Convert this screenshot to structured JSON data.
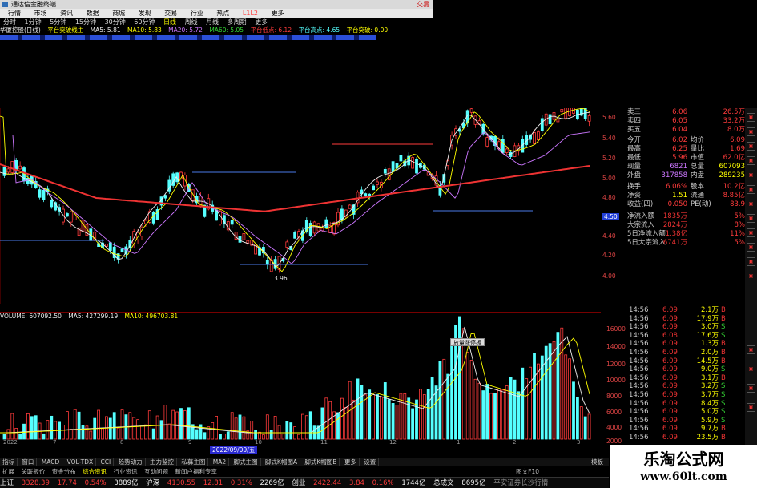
{
  "titlebar": {
    "title": "通达信金融终端",
    "right_label": "交易"
  },
  "menubar": {
    "items": [
      "行情",
      "市场",
      "资讯",
      "数据",
      "商城",
      "发现",
      "交易",
      "行业",
      "热点",
      "L1L2",
      "更多"
    ]
  },
  "periodbar": {
    "items": [
      "分时",
      "1分钟",
      "5分钟",
      "15分钟",
      "30分钟",
      "60分钟",
      "日线",
      "周线",
      "月线",
      "多周期",
      "更多"
    ],
    "active": "日线"
  },
  "maline": {
    "stock": "华厦控股(日线)",
    "indicator": "平台突破线主",
    "ma5": "MA5: 5.81",
    "ma10": "MA10: 5.83",
    "ma20": "MA20: 5.72",
    "ma60": "MA60: 5.05",
    "pt_low": "平台低点: 6.12",
    "pt_high": "平台高点: 4.65",
    "pt_break": "平台突破: 0.00"
  },
  "chart_axis": {
    "price_ticks": [
      "5.60",
      "5.40",
      "5.20",
      "5.00",
      "4.80",
      "4.60",
      "4.40",
      "4.20",
      "4.00"
    ],
    "price_marker": "4.50",
    "low_label": "3.96",
    "volume_ticks": [
      "16000",
      "14000",
      "12000",
      "10000",
      "8000",
      "6000",
      "4000",
      "2000"
    ],
    "x_labels": [
      "2022",
      "7",
      "8",
      "9",
      "10",
      "11",
      "12",
      "1",
      "2",
      "3"
    ],
    "date_tag": "2022/09/09/五"
  },
  "volbar": {
    "label": "VOLUME: 607092.50",
    "ma5": "MA5: 427299.19",
    "ma10": "MA10: 496703.81"
  },
  "tooltip": "放量涨停板",
  "quote": {
    "rows": [
      {
        "a": "卖三",
        "b": "6.06",
        "d": "26.5万"
      },
      {
        "a": "卖四",
        "b": "6.05",
        "d": "33.2万"
      },
      {
        "a": "买五",
        "b": "6.04",
        "d": "8.0万"
      },
      {
        "a": "今开",
        "b": "6.02",
        "c": "均价",
        "d": "6.09"
      },
      {
        "a": "最高",
        "b": "6.25",
        "c": "量比",
        "d": "1.69"
      },
      {
        "a": "最低",
        "b": "5.96",
        "c": "市值",
        "d": "62.0亿"
      },
      {
        "a": "现量",
        "b": "6821",
        "c": "总量",
        "d": "607093"
      },
      {
        "a": "外盘",
        "b": "317858",
        "c": "内盘",
        "d": "289235"
      },
      {
        "a": "换手",
        "b": "6.06%",
        "c": "股本",
        "d": "10.2亿"
      },
      {
        "a": "净资",
        "b": "1.51",
        "c": "流通",
        "d": "8.85亿"
      },
      {
        "a": "收益(四)",
        "b": "0.050",
        "c": "PE(动)",
        "d": "83.9"
      },
      {
        "a": "净流入额",
        "b": "1835万",
        "d": "5%"
      },
      {
        "a": "大宗流入",
        "b": "2824万",
        "d": "8%"
      },
      {
        "a": "5日净流入额",
        "b": "1.38亿",
        "d": "11%"
      },
      {
        "a": "5日大宗流入",
        "b": "6741万",
        "d": "5%"
      }
    ]
  },
  "ticks": {
    "rows": [
      {
        "t": "14:56",
        "p": "6.09",
        "v": "2.1万",
        "s": "B"
      },
      {
        "t": "14:56",
        "p": "6.09",
        "v": "17.9万",
        "s": "B"
      },
      {
        "t": "14:56",
        "p": "6.09",
        "v": "3.0万",
        "s": "S"
      },
      {
        "t": "14:56",
        "p": "6.08",
        "v": "17.6万",
        "s": "S"
      },
      {
        "t": "14:56",
        "p": "6.09",
        "v": "1.3万",
        "s": "B"
      },
      {
        "t": "14:56",
        "p": "6.09",
        "v": "2.0万",
        "s": "B"
      },
      {
        "t": "14:56",
        "p": "6.09",
        "v": "14.5万",
        "s": "B"
      },
      {
        "t": "14:56",
        "p": "6.09",
        "v": "9.0万",
        "s": "S"
      },
      {
        "t": "14:56",
        "p": "6.09",
        "v": "3.1万",
        "s": "B"
      },
      {
        "t": "14:56",
        "p": "6.09",
        "v": "3.2万",
        "s": "S"
      },
      {
        "t": "14:56",
        "p": "6.09",
        "v": "3.7万",
        "s": "S"
      },
      {
        "t": "14:56",
        "p": "6.09",
        "v": "8.4万",
        "s": "S"
      },
      {
        "t": "14:56",
        "p": "6.09",
        "v": "5.0万",
        "s": "S"
      },
      {
        "t": "14:56",
        "p": "6.09",
        "v": "5.9万",
        "s": "S"
      },
      {
        "t": "14:56",
        "p": "6.09",
        "v": "9.7万",
        "s": "B"
      },
      {
        "t": "14:56",
        "p": "6.09",
        "v": "23.5万",
        "s": "B"
      }
    ]
  },
  "tabbar": {
    "items": [
      "指标",
      "窗口",
      "MACD",
      "VOL-TDX",
      "CCI",
      "趋势动力",
      "主力监控",
      "私募主图",
      "MA2",
      "脚式主图",
      "脚式K帽图A",
      "脚式K帽图B",
      "更多",
      "设置"
    ],
    "right": "模板"
  },
  "tabbar2": {
    "items": [
      "扩展",
      "关联报价",
      "资金分布",
      "综合资讯",
      "行业资讯",
      "互动问题",
      "新闻户福利专享"
    ],
    "highlight": "综合资讯",
    "right": "图文F10"
  },
  "statusbar": {
    "sh_label": "上证",
    "sh_value": "3328.39",
    "sh_change": "17.74",
    "sh_pct": "0.54%",
    "sh_amount": "3889亿",
    "sz_label": "沪深",
    "sz_value": "4130.55",
    "sz_change": "12.81",
    "sz_pct": "0.31%",
    "sz_amount": "2269亿",
    "cy_label": "创业",
    "cy_value": "2422.44",
    "cy_change": "3.84",
    "cy_pct": "0.16%",
    "cy_amount": "1744亿",
    "total_label": "总成交",
    "total_value": "8695亿",
    "broker": "平安证券长沙行情"
  },
  "watermark": {
    "line1": "乐淘公式网",
    "line2": "www.60lt.com"
  },
  "colors": {
    "up": "#ff3b3b",
    "down": "#5ff",
    "ma5": "#eee",
    "ma10": "#ff0",
    "ma20": "#c7f",
    "ma60": "#e33"
  }
}
